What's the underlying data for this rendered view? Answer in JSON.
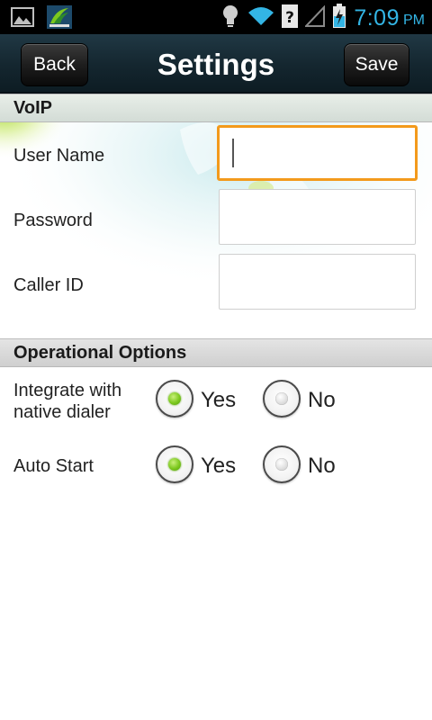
{
  "status_bar": {
    "time": "7:09",
    "ampm": "PM",
    "icons": [
      "gallery-icon",
      "app-notification-icon",
      "lightbulb-icon",
      "wifi-icon",
      "unknown-network-icon",
      "signal-icon",
      "battery-charging-icon"
    ]
  },
  "header": {
    "title": "Settings",
    "back_label": "Back",
    "save_label": "Save"
  },
  "voip": {
    "section_title": "VoIP",
    "user_name_label": "User Name",
    "user_name_value": "",
    "password_label": "Password",
    "password_value": "",
    "caller_id_label": "Caller ID",
    "caller_id_value": ""
  },
  "operational": {
    "section_title": "Operational Options",
    "integrate_label_line1": "Integrate with",
    "integrate_label_line2": "native dialer",
    "integrate_value": "Yes",
    "auto_start_label": "Auto Start",
    "auto_start_value": "Yes",
    "yes_label": "Yes",
    "no_label": "No"
  },
  "colors": {
    "accent_focus": "#f39a1c",
    "status_time": "#33b5e5",
    "radio_selected": "#7cc81e"
  }
}
